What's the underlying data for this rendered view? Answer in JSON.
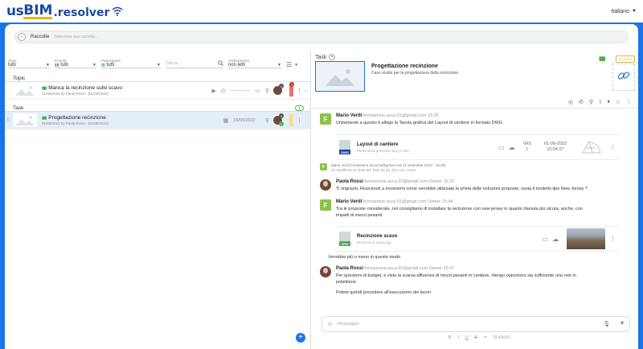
{
  "brand": {
    "part1": "us",
    "part2": "BIM",
    "part3": ".resolver"
  },
  "language": {
    "label": "Italiano"
  },
  "breadcrumb": {
    "title": "Raccolte",
    "placeholder": "Seleziona una raccolta..."
  },
  "filters": {
    "stato": {
      "label": "Stato",
      "value": "tutti"
    },
    "priorita": {
      "label": "Priorità",
      "value": "tutti"
    },
    "partecipanti": {
      "label": "Partecipanti",
      "value": "tutti"
    },
    "search_placeholder": "Cerca...",
    "ordinamento": {
      "label": "Ordinamento",
      "value": "non letti"
    }
  },
  "topic": {
    "section_label": "Topic",
    "items": [
      {
        "title": "Manca la recinzione sullo scavo",
        "meta": "01/09/2022 by Paola Rossi - [01/09/2022]",
        "avatar_count": "4",
        "unread": "1",
        "flag_color": "#e57373"
      }
    ]
  },
  "task": {
    "section_label": "Task",
    "count": "1",
    "items": [
      {
        "title": "Progettazione recinzione",
        "meta": "01/09/2022 by Paola Rossi - [01/09/2022]",
        "date": "16/09/2022",
        "avatar_count": "4",
        "flag_color": "#f5e08a"
      }
    ]
  },
  "detail": {
    "header": "Task",
    "title": "Progettazione recinzione",
    "description": "Caso studio per la progettazione della recinzione",
    "status": "In corso",
    "colors": {
      "accent": "#1a73e8",
      "progress": "#4caf50"
    }
  },
  "messages": {
    "m1": {
      "author": "Mario Verdi",
      "email": "formazione.acca.01@gmail.com",
      "time": "15:25",
      "text": "Unitamente a questo ti allego la Tavola grafica del Layout di cantiere in formato DWG",
      "attachment": {
        "name": "Layout di cantiere",
        "file": "Planimetria generale.dwg",
        "size": "(4 KB)",
        "type": "DWG",
        "vrs_label": "VRS",
        "vrs": "1",
        "date": "01-09-2022",
        "time": "15:04:27"
      }
    },
    "log": {
      "author": "Mario Verdi",
      "email": "formazione.acca.01@gmail.com",
      "when": "[1 settembre 2022 - 15:25]",
      "text": "ha modificato lo stato del Task da da_fare a in_corso"
    },
    "m2": {
      "author": "Paola Rossi",
      "email": "formazione.acca.02@gmail.com",
      "role": "Owner",
      "time": "15:37",
      "text": "Ti ringrazio, Riusciresti a mostrarmi come verrebbe utilizzata la prima delle soluzioni proposte, ossia il modello tipo New Jersey ?"
    },
    "m3": {
      "author": "Mario Verdi",
      "email": "formazione.acca.01@gmail.com",
      "role": "Owner",
      "time": "15:44",
      "text1": "Tra le proposte considerate, noi consigliamo di installare la recinzione con new jersey in quanto ritenuta più sicura, anche, con",
      "text2": "impatti di mezzi pesanti.",
      "attachment": {
        "name": "Recinzione scavo",
        "file": "Recinzione scavo.jpg",
        "type": "JPG"
      },
      "after": "Verrebbe più o meno in questo modo"
    },
    "m4": {
      "author": "Paola Rossi",
      "email": "formazione.acca.02@gmail.com",
      "role": "Owner",
      "time": "15:47",
      "text1": "Per questioni di budget, e vista la scarsa affluenza di mezzi pesanti in cantiere, ritengo opportuno sia sufficiente una rete in",
      "text2": "polietilene.",
      "text3": "Potete quindi procedere all'esecuzione dei lavori"
    }
  },
  "composer": {
    "placeholder": "Messaggio",
    "format_hint": "\\(LaTeX\\)"
  }
}
